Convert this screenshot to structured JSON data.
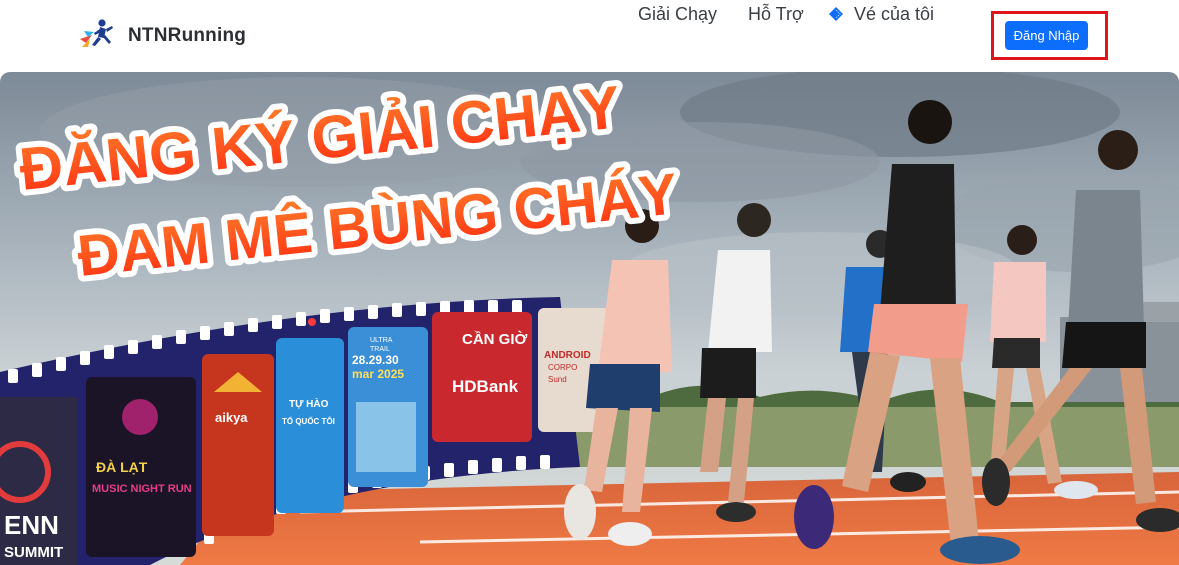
{
  "brand": {
    "name": "NTNRunning",
    "logo_icon": "runner-logo-icon"
  },
  "nav": {
    "items": [
      {
        "label": "Giải Chạy"
      },
      {
        "label": "Hỗ Trợ"
      },
      {
        "label": "Vé của tôi",
        "icon": "ticket-icon"
      }
    ],
    "login_label": "Đăng Nhập"
  },
  "hero": {
    "headline_line1": "ĐĂNG KÝ GIẢI CHẠY",
    "headline_line2": "ĐAM MÊ BÙNG CHÁY",
    "posters": [
      {
        "lines": [
          "ENN",
          "SUMMIT"
        ]
      },
      {
        "lines": [
          "ĐÀ LẠT",
          "MUSIC NIGHT RUN"
        ]
      },
      {
        "lines": [
          "aikya"
        ]
      },
      {
        "lines": [
          "TỰ HÀO",
          "TỔ QUỐC TÔI"
        ]
      },
      {
        "lines": [
          "ULTRA",
          "TRAIL",
          "28.29.30",
          "mar 2025"
        ]
      },
      {
        "lines": [
          "CẦN GIỜ",
          "HDBank"
        ]
      },
      {
        "lines": [
          "ANDROID",
          "CORPO",
          "Sund"
        ]
      }
    ]
  },
  "colors": {
    "primary": "#0d6efd",
    "highlight_border": "#e0141b",
    "headline": "#ff4b14",
    "track": "#e8683a",
    "film": "#25256e"
  }
}
